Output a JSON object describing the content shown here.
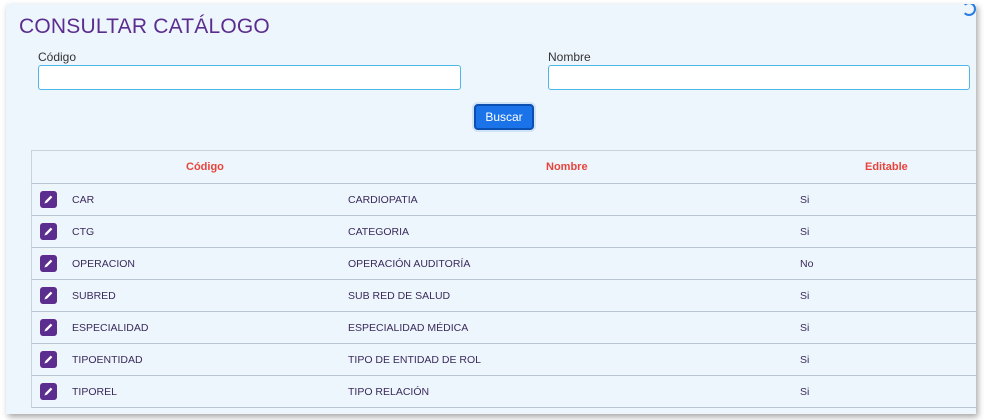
{
  "page": {
    "title": "CONSULTAR CATÁLOGO"
  },
  "form": {
    "codigo_label": "Código",
    "codigo_value": "",
    "nombre_label": "Nombre",
    "nombre_value": "",
    "search_button": "Buscar"
  },
  "table": {
    "headers": [
      "Código",
      "Nombre",
      "Editable"
    ],
    "rows": [
      {
        "codigo": "CAR",
        "nombre": "CARDIOPATIA",
        "editable": "Si"
      },
      {
        "codigo": "CTG",
        "nombre": "CATEGORIA",
        "editable": "Si"
      },
      {
        "codigo": "OPERACION",
        "nombre": "OPERACIÓN AUDITORÍA",
        "editable": "No"
      },
      {
        "codigo": "SUBRED",
        "nombre": "SUB RED DE SALUD",
        "editable": "Si"
      },
      {
        "codigo": "ESPECIALIDAD",
        "nombre": "ESPECIALIDAD MÉDICA",
        "editable": "Si"
      },
      {
        "codigo": "TIPOENTIDAD",
        "nombre": "TIPO DE ENTIDAD DE ROL",
        "editable": "Si"
      },
      {
        "codigo": "TIPOREL",
        "nombre": "TIPO RELACIÓN",
        "editable": "Si"
      }
    ]
  },
  "colors": {
    "title": "#5b2d8e",
    "header_text": "#e8443c",
    "button": "#1a73e8",
    "edit_icon_bg": "#5b2d8e"
  },
  "icons": {
    "row_action": "pencil-icon",
    "corner": "refresh-icon"
  }
}
